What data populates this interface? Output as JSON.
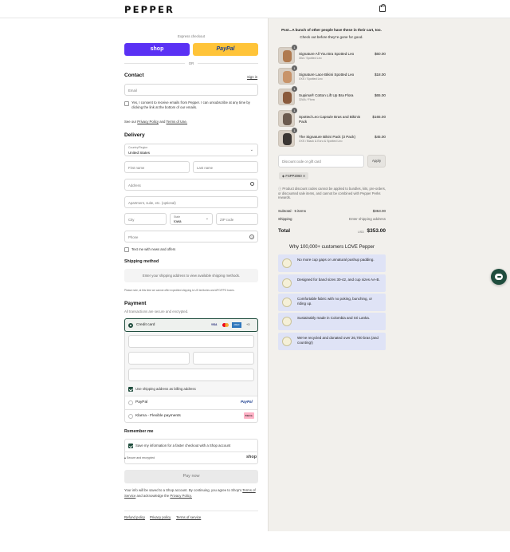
{
  "header": {
    "logo": "PEPPER"
  },
  "express": {
    "label": "Express checkout",
    "shop": "shop",
    "paypal": "PayPal",
    "or": "OR"
  },
  "contact": {
    "title": "Contact",
    "sign_in": "Sign in",
    "email_placeholder": "Email",
    "consent_text": "Yes, I consent to receive emails from Pepper. I can unsubscribe at any time by clicking the link at the bottom of our emails.",
    "policy_prefix": "See our",
    "privacy_link": "Privacy Policy",
    "and": "and",
    "terms_link": "Terms of Use."
  },
  "delivery": {
    "title": "Delivery",
    "country_label": "Country/Region",
    "country_value": "United States",
    "first_name": "First name",
    "last_name": "Last name",
    "address": "Address",
    "apartment": "Apartment, suite, etc. (optional)",
    "city": "City",
    "state_label": "State",
    "state_value": "Iowa",
    "zip": "ZIP code",
    "phone": "Phone",
    "text_me": "Text me with news and offers"
  },
  "shipping": {
    "title": "Shipping method",
    "placeholder": "Enter your shipping address to view available shipping methods.",
    "note": "Please note, at this time we cannot offer expedited shipping to US territories and APO/FPO boxes."
  },
  "payment": {
    "title": "Payment",
    "subtitle": "All transactions are secure and encrypted.",
    "credit_card": "Credit card",
    "card_brands": [
      "VISA",
      "MC",
      "AMEX",
      "+3"
    ],
    "billing_same": "Use shipping address as billing address",
    "paypal": "PayPal",
    "klarna": "Klarna - Flexible payments",
    "klarna_badge": "Klarna."
  },
  "remember": {
    "title": "Remember me",
    "save_info": "Save my information for a faster checkout with a Shop account",
    "secure": "Secure and encrypted",
    "shop": "shop"
  },
  "pay_now": "Pay now",
  "legal": {
    "line1": "Your info will be saved to a Shop account. By continuing, you agree to Shop's",
    "terms": "Terms of Service",
    "mid": "and acknowledge the",
    "privacy": "Privacy Policy."
  },
  "footer_links": [
    "Refund policy",
    "Privacy policy",
    "Terms of service"
  ],
  "summary": {
    "promo_title": "Psst...A bunch of other people have these in their cart, too.",
    "promo_sub": "Check out before they're gone for good.",
    "items": [
      {
        "name": "Signature All You Bra Spotted Leo",
        "variant": "30A / Spotted Leo",
        "price": "$60.00",
        "qty": "1",
        "color": "#b07a4f"
      },
      {
        "name": "Signature Lace Bikini Spotted Leo",
        "variant": "XXS / Spotted Leo",
        "price": "$18.00",
        "qty": "1",
        "color": "#c8946a"
      },
      {
        "name": "Supima® Cotton Lift Up Bra Flora",
        "variant": "32AA / Flora",
        "price": "$65.00",
        "qty": "1",
        "color": "#8a5a3c"
      },
      {
        "name": "Spotted Leo Capsule Bras and Bikinis Pack",
        "variant": "",
        "price": "$165.00",
        "qty": "1",
        "color": "#6b5a4e"
      },
      {
        "name": "The Signature Bikini Pack (3 Pack)",
        "variant": "XXS / Black & Ecru & Spotted Leo",
        "price": "$45.00",
        "qty": "1",
        "color": "#3b3633"
      }
    ],
    "discount_placeholder": "Discount code or gift card",
    "apply": "Apply",
    "code": "FSPP2060",
    "discount_note": "Product discount codes cannot be applied to bundles, kits, pre-orders, or discounted sale items, and cannot be combined with Pepper Perks rewards.",
    "subtotal_label": "Subtotal · 5 items",
    "subtotal_value": "$353.00",
    "shipping_label": "Shipping",
    "shipping_value": "Enter shipping address",
    "total_label": "Total",
    "currency": "USD",
    "total_value": "$353.00"
  },
  "why": {
    "title": "Why 100,000+ customers LOVE Pepper",
    "items": [
      "No more cup gaps or unnatural pushup padding.",
      "Designed for band sizes 30-42, and cup sizes AA-B.",
      "Comfortable fabric with no poking, bunching, or riding up.",
      "Sustainably made in Colombia and Sri Lanka.",
      "We've recycled and donated over 26,700 bras (and counting!)"
    ]
  },
  "colors": {
    "shop": "#5a31f4",
    "paypal": "#ffc439",
    "brand_green": "#1f4d3d",
    "why_bg": "#dfe3f6"
  }
}
